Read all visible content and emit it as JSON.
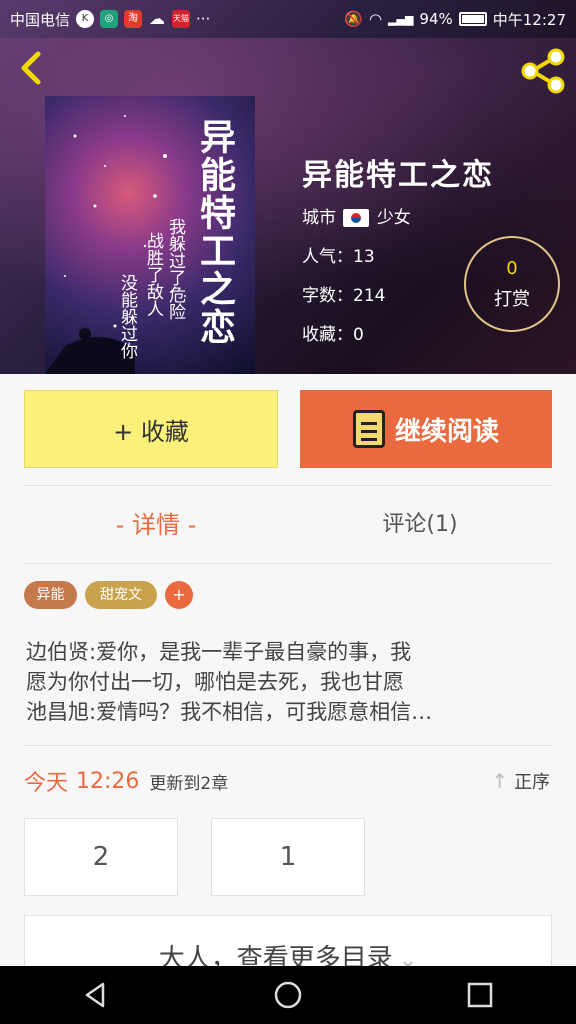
{
  "status_bar": {
    "carrier": "中国电信",
    "app_icons": [
      "K",
      "WiFi",
      "淘",
      "cloud",
      "天猫"
    ],
    "more": "···",
    "signal_label": "46\n26",
    "battery": "94%",
    "network_label": "中",
    "time": "中午12:27"
  },
  "header": {
    "back_icon": "chevron-left-icon",
    "share_icon": "share-icon",
    "cover": {
      "title": "异能特工之恋",
      "lines": [
        "我躲过了危险",
        "战胜了敌人",
        "没能躲过你"
      ]
    },
    "book_title": "异能特工之恋",
    "category_prefix": "城市",
    "category_suffix": "少女",
    "popularity_label": "人气：",
    "popularity_value": "13",
    "words_label": "字数：",
    "words_value": "214",
    "favorites_label": "收藏：",
    "favorites_value": "0",
    "tip_count": "0",
    "tip_label": "打赏"
  },
  "actions": {
    "collect_label": "+ 收藏",
    "read_label": "继续阅读"
  },
  "tabs": {
    "detail": "- 详情 -",
    "comment": "评论(1)"
  },
  "tags": [
    "异能",
    "甜宠文",
    "+"
  ],
  "intro": {
    "lines": [
      "边伯贤:爱你，是我一辈子最自豪的事，我",
      "愿为你付出一切，哪怕是去死，我也甘愿",
      "池昌旭:爱情吗？我不相信，可我愿意相信…"
    ]
  },
  "update": {
    "today": "今天",
    "time": "12:26",
    "text": "更新到2章",
    "sort_label": "正序"
  },
  "chapters": [
    "2",
    "1"
  ],
  "more_label": "大人，查看更多目录",
  "colors": {
    "accent": "#ea6a40",
    "collect_bg": "#fbf07a",
    "tip_gold": "#f0d800"
  }
}
